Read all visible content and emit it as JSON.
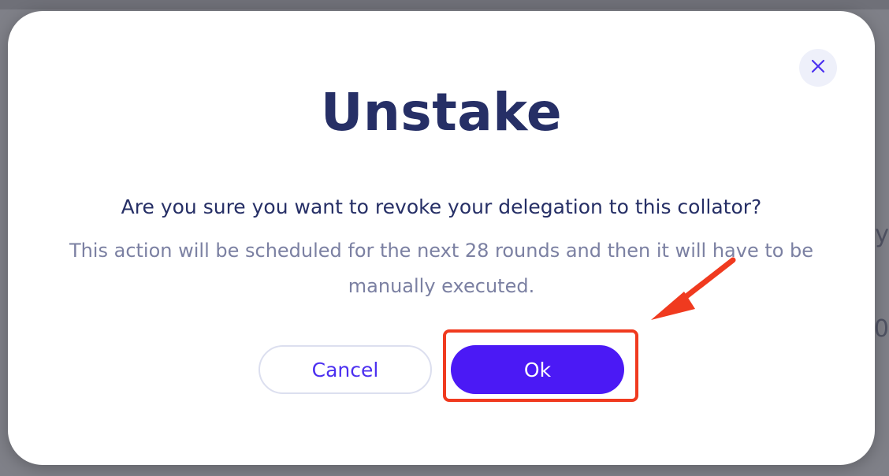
{
  "modal": {
    "title": "Unstake",
    "question": "Are you sure you want to revoke your delegation to this collator?",
    "description": "This action will be scheduled for the next 28 rounds and then it will have to be manually executed.",
    "close_icon": "close-icon",
    "buttons": {
      "cancel_label": "Cancel",
      "ok_label": "Ok"
    }
  },
  "annotation": {
    "highlight_color": "#f03a1f",
    "arrow_color": "#f03a1f"
  },
  "colors": {
    "primary": "#4b19f5",
    "title": "#262f66",
    "muted_text": "#7b80a2",
    "overlay": "#7f8088"
  }
}
